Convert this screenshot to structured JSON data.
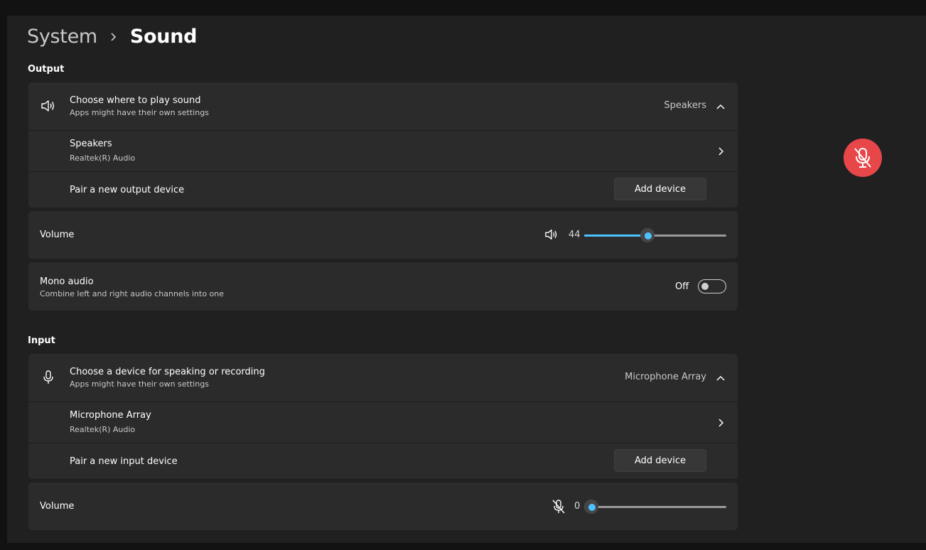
{
  "breadcrumb": {
    "parent": "System",
    "current": "Sound"
  },
  "output": {
    "section_label": "Output",
    "choose": {
      "title": "Choose where to play sound",
      "subtitle": "Apps might have their own settings",
      "selected": "Speakers"
    },
    "device": {
      "name": "Speakers",
      "driver": "Realtek(R) Audio"
    },
    "pair": {
      "label": "Pair a new output device",
      "button": "Add device"
    },
    "volume": {
      "label": "Volume",
      "value": "44",
      "level": 0.44
    },
    "mono": {
      "title": "Mono audio",
      "subtitle": "Combine left and right audio channels into one",
      "state": "Off"
    }
  },
  "input": {
    "section_label": "Input",
    "choose": {
      "title": "Choose a device for speaking or recording",
      "subtitle": "Apps might have their own settings",
      "selected": "Microphone Array"
    },
    "device": {
      "name": "Microphone Array",
      "driver": "Realtek(R) Audio"
    },
    "pair": {
      "label": "Pair a new input device",
      "button": "Add device"
    },
    "volume": {
      "label": "Volume",
      "value": "0",
      "level": 0
    }
  },
  "colors": {
    "accent": "#4cc2ff",
    "mute_badge": "#e8474a",
    "card": "#2b2b2b",
    "background": "#202020"
  },
  "icons": [
    "speaker-icon",
    "chevron-up-icon",
    "chevron-right-icon",
    "microphone-icon",
    "microphone-muted-icon",
    "muted-mic-badge-icon"
  ]
}
